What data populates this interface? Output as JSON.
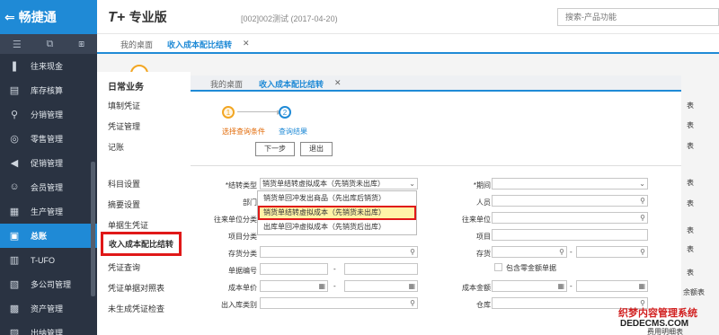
{
  "brand": {
    "arrow": "⇐",
    "title": "畅捷通"
  },
  "side_tools": [
    "☰",
    "⧉",
    "⧆"
  ],
  "nav": [
    {
      "label": "往来现金",
      "icon": "❚"
    },
    {
      "label": "库存核算",
      "icon": "▤"
    },
    {
      "label": "分销管理",
      "icon": "⚲"
    },
    {
      "label": "零售管理",
      "icon": "◎"
    },
    {
      "label": "促销管理",
      "icon": "◀"
    },
    {
      "label": "会员管理",
      "icon": "☺"
    },
    {
      "label": "生产管理",
      "icon": "▦"
    },
    {
      "label": "总账",
      "icon": "▣"
    },
    {
      "label": "T-UFO",
      "icon": "▥"
    },
    {
      "label": "多公司管理",
      "icon": "▧"
    },
    {
      "label": "资产管理",
      "icon": "▩"
    },
    {
      "label": "出纳管理",
      "icon": "▨"
    }
  ],
  "header": {
    "logo_prefix": "T+",
    "logo_suffix": "专业版",
    "account": "[002]002测试  (2017-04-20)",
    "search_placeholder": "搜索-产品功能"
  },
  "outer_tabs": {
    "home": "我的桌面",
    "active": "收入成本配比结转",
    "close": "✕"
  },
  "func_menu": {
    "title": "日常业务",
    "items": [
      "填制凭证",
      "凭证管理",
      "记账",
      "科目设置",
      "摘要设置",
      "单据生凭证",
      "收入成本配比结转",
      "凭证查询",
      "凭证单据对照表",
      "未生成凭证检查"
    ]
  },
  "inner_tabs": {
    "home": "我的桌面",
    "active": "收入成本配比结转",
    "close": "✕"
  },
  "steps": {
    "one": "1",
    "two": "2",
    "label_one": "选择查询条件",
    "label_two": "查询结果",
    "arrow": "▶"
  },
  "buttons": {
    "next": "下一步",
    "exit": "退出"
  },
  "form": {
    "transfer_type_label": "*结转类型",
    "transfer_type_value": "销货单结转虚拟成本（先销货未出库）",
    "period_label": "*期间",
    "dept_label": "部门",
    "person_label": "人员",
    "partner_class_label": "往来单位分类",
    "partner_label": "往来单位",
    "item_class_label": "项目分类",
    "item_label": "项目",
    "stock_class_label": "存货分类",
    "stock_label": "存货",
    "doc_no_label": "单据编号",
    "zero_amount_label": "包含零金额单据",
    "unit_cost_label": "成本单价",
    "cost_amount_label": "成本金额",
    "io_type_label": "出入库类别",
    "warehouse_label": "仓库",
    "range_dash": "-",
    "dropdown_arrow": "⌄",
    "search_glyph": "⚲",
    "calc_glyph": "▦"
  },
  "dropdown_options": [
    "销货单回冲发出商品（先出库后销货）",
    "销货单结转虚拟成本（先销货未出库）",
    "出库单回冲虚拟成本（先销货后出库）"
  ],
  "right_col": [
    "表",
    "表",
    "表",
    "表",
    "表",
    "表",
    "表",
    "余额表",
    "表"
  ],
  "right_footer": "费用明细表",
  "watermark": {
    "line1": "织梦内容管理系统",
    "line2": "DEDECMS.COM"
  }
}
